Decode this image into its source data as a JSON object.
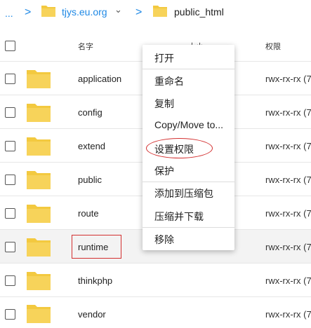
{
  "breadcrumb": {
    "ellipsis": "...",
    "sep": ">",
    "parent": "tjys.eu.org",
    "chevron": "⌄",
    "current": "public_html"
  },
  "header": {
    "name": "名字",
    "size": "大小",
    "permissions": "权限"
  },
  "rows": [
    {
      "name": "application",
      "perm": "rwx-rx-rx (7"
    },
    {
      "name": "config",
      "perm": "rwx-rx-rx (7"
    },
    {
      "name": "extend",
      "perm": "rwx-rx-rx (7"
    },
    {
      "name": "public",
      "perm": "rwx-rx-rx (7"
    },
    {
      "name": "route",
      "perm": "rwx-rx-rx (7"
    },
    {
      "name": "runtime",
      "perm": "rwx-rx-rx (7"
    },
    {
      "name": "thinkphp",
      "perm": "rwx-rx-rx (7"
    },
    {
      "name": "vendor",
      "perm": "rwx-rx-rx (7"
    }
  ],
  "context_menu": [
    "打开",
    "重命名",
    "复制",
    "Copy/Move to...",
    "设置权限",
    "保护",
    "添加到压缩包",
    "压缩并下载",
    "移除"
  ],
  "colors": {
    "folder": "#f3c93f",
    "accent": "#1e88e5",
    "annotation": "#d32f2f"
  }
}
